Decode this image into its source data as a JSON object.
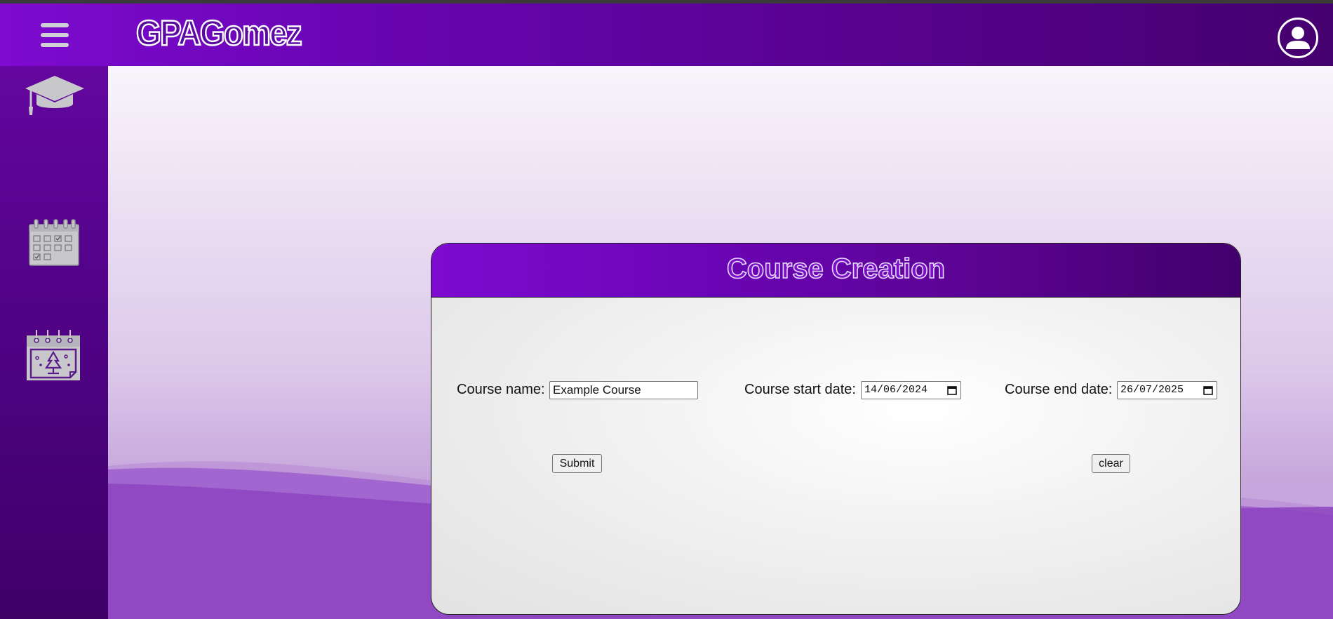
{
  "app": {
    "brand": "GPAGomez"
  },
  "header": {
    "menu_icon": "hamburger-menu-icon",
    "profile_icon": "user-avatar-icon"
  },
  "sidebar": {
    "items": [
      {
        "icon": "graduation-cap-icon"
      },
      {
        "icon": "calendar-icon"
      },
      {
        "icon": "holiday-calendar-icon"
      }
    ]
  },
  "form": {
    "title": "Course Creation",
    "course_name_label": "Course name:",
    "course_name_value": "Example Course",
    "start_date_label": "Course start date:",
    "start_date_value": "14/06/2024",
    "end_date_label": "Course end date:",
    "end_date_value": "26/07/2025",
    "submit_label": "Submit",
    "clear_label": "clear"
  },
  "colors": {
    "brand_purple": "#7e0bd0",
    "brand_dark": "#45006f",
    "sidebar_icon_grey": "#c8c8cc"
  }
}
